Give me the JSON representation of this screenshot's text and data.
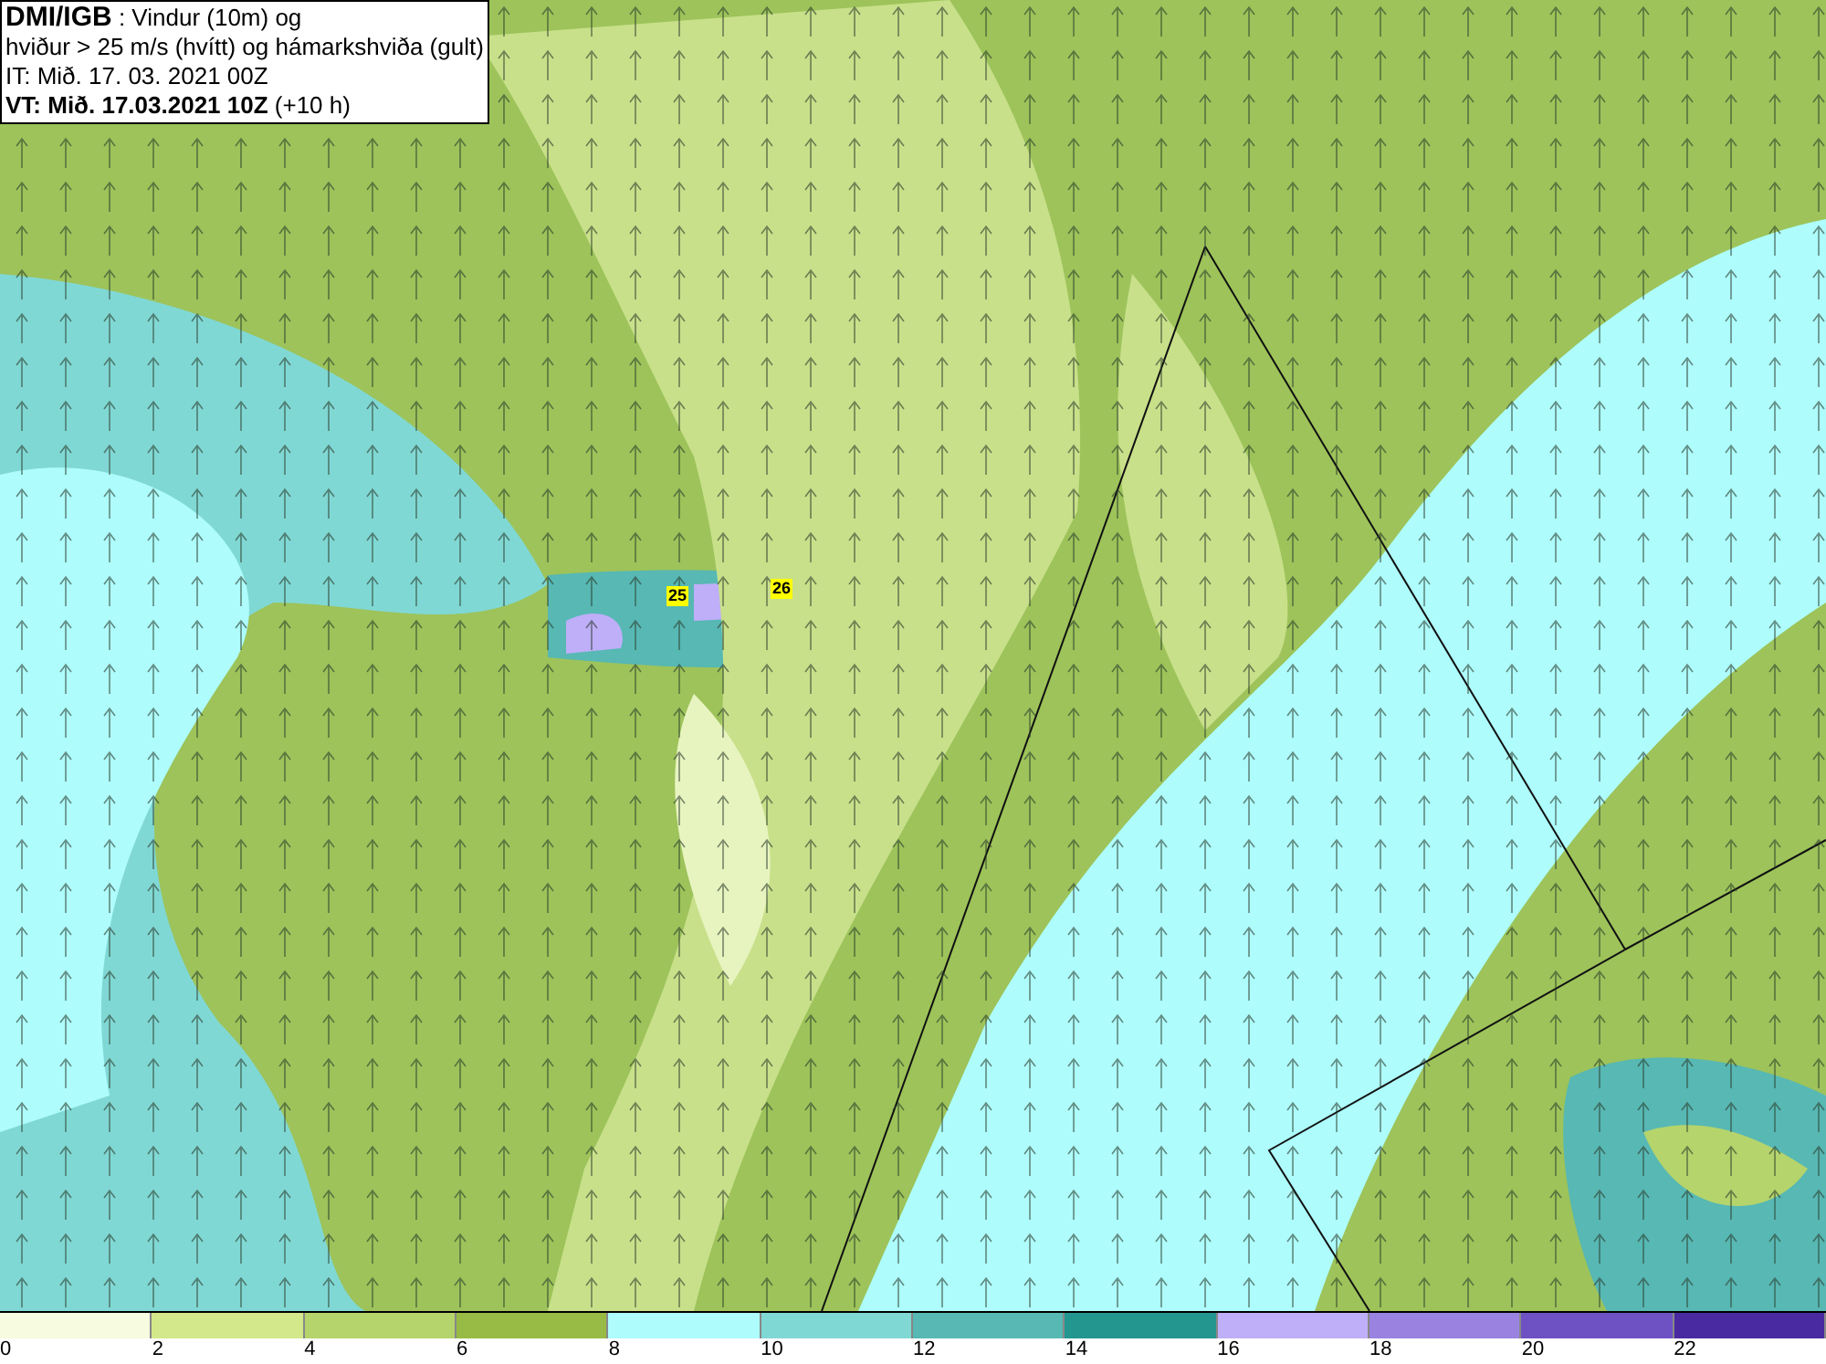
{
  "header": {
    "source": "DMI/IGB",
    "title_line_1": " : Vindur (10m) og",
    "title_line_2": "hviður > 25 m/s (hvítt) og hámarkshviða (gult)",
    "issue_time": "IT: Mið. 17. 03. 2021 00Z",
    "valid_time": "VT: Mið. 17.03.2021 10Z",
    "lead_time": " (+10 h)"
  },
  "gust_labels": [
    "25",
    "26"
  ],
  "legend": {
    "segments": [
      {
        "color": "#f7fbe0"
      },
      {
        "color": "#d2e88a"
      },
      {
        "color": "#b5d46c"
      },
      {
        "color": "#97bb44"
      },
      {
        "color": "#aefcfc"
      },
      {
        "color": "#80d8d4"
      },
      {
        "color": "#57b8b4"
      },
      {
        "color": "#239690"
      },
      {
        "color": "#bfaef8"
      },
      {
        "color": "#9a82e0"
      },
      {
        "color": "#6e52c4"
      },
      {
        "color": "#4a2aa0"
      }
    ],
    "ticks": [
      "0",
      "2",
      "4",
      "6",
      "8",
      "10",
      "12",
      "14",
      "16",
      "18",
      "20",
      "22"
    ]
  }
}
